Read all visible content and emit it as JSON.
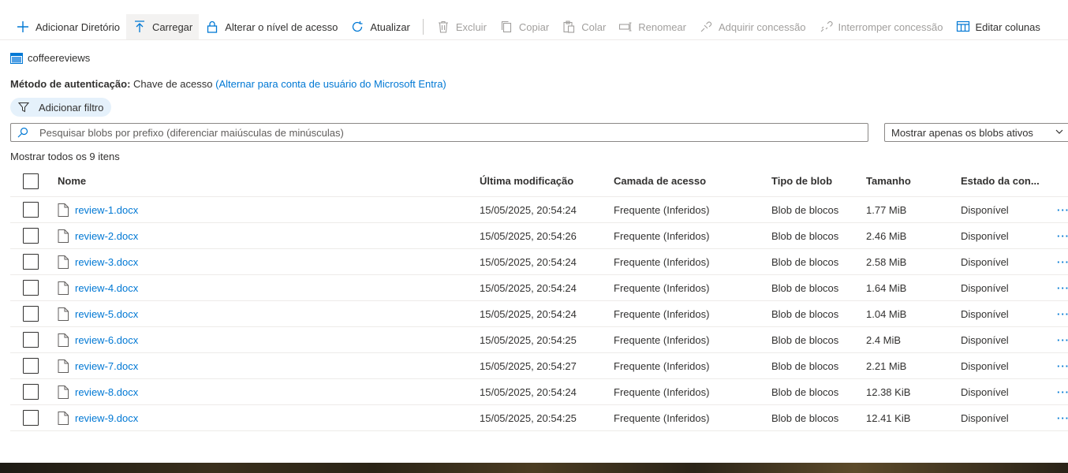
{
  "toolbar": {
    "add_directory": "Adicionar Diretório",
    "upload": "Carregar",
    "change_access": "Alterar o nível de acesso",
    "refresh": "Atualizar",
    "delete": "Excluir",
    "copy": "Copiar",
    "paste": "Colar",
    "rename": "Renomear",
    "acquire_lease": "Adquirir concessão",
    "break_lease": "Interromper concessão",
    "edit_columns": "Editar colunas"
  },
  "container_name": "coffeereviews",
  "auth": {
    "label": "Método de autenticação:",
    "value": "Chave de acesso",
    "switch_link": "(Alternar para conta de usuário do Microsoft Entra)"
  },
  "filter_button": "Adicionar filtro",
  "search": {
    "placeholder": "Pesquisar blobs por prefixo (diferenciar maiúsculas de minúsculas)",
    "value": ""
  },
  "blob_filter": {
    "selected": "Mostrar apenas os blobs ativos"
  },
  "items_count_label": "Mostrar todos os 9 itens",
  "columns": {
    "name": "Nome",
    "modified": "Última modificação",
    "tier": "Camada de acesso",
    "type": "Tipo de blob",
    "size": "Tamanho",
    "state": "Estado da con..."
  },
  "rows": [
    {
      "name": "review-1.docx",
      "modified": "15/05/2025, 20:54:24",
      "tier": "Frequente (Inferidos)",
      "type": "Blob de blocos",
      "size": "1.77 MiB",
      "state": "Disponível",
      "more": "···"
    },
    {
      "name": "review-2.docx",
      "modified": "15/05/2025, 20:54:26",
      "tier": "Frequente (Inferidos)",
      "type": "Blob de blocos",
      "size": "2.46 MiB",
      "state": "Disponível",
      "more": "···"
    },
    {
      "name": "review-3.docx",
      "modified": "15/05/2025, 20:54:24",
      "tier": "Frequente (Inferidos)",
      "type": "Blob de blocos",
      "size": "2.58 MiB",
      "state": "Disponível",
      "more": "···"
    },
    {
      "name": "review-4.docx",
      "modified": "15/05/2025, 20:54:24",
      "tier": "Frequente (Inferidos)",
      "type": "Blob de blocos",
      "size": "1.64 MiB",
      "state": "Disponível",
      "more": "···"
    },
    {
      "name": "review-5.docx",
      "modified": "15/05/2025, 20:54:24",
      "tier": "Frequente (Inferidos)",
      "type": "Blob de blocos",
      "size": "1.04 MiB",
      "state": "Disponível",
      "more": "···"
    },
    {
      "name": "review-6.docx",
      "modified": "15/05/2025, 20:54:25",
      "tier": "Frequente (Inferidos)",
      "type": "Blob de blocos",
      "size": "2.4 MiB",
      "state": "Disponível",
      "more": "···"
    },
    {
      "name": "review-7.docx",
      "modified": "15/05/2025, 20:54:27",
      "tier": "Frequente (Inferidos)",
      "type": "Blob de blocos",
      "size": "2.21 MiB",
      "state": "Disponível",
      "more": "···"
    },
    {
      "name": "review-8.docx",
      "modified": "15/05/2025, 20:54:24",
      "tier": "Frequente (Inferidos)",
      "type": "Blob de blocos",
      "size": "12.38 KiB",
      "state": "Disponível",
      "more": "···"
    },
    {
      "name": "review-9.docx",
      "modified": "15/05/2025, 20:54:25",
      "tier": "Frequente (Inferidos)",
      "type": "Blob de blocos",
      "size": "12.41 KiB",
      "state": "Disponível",
      "more": "···"
    }
  ],
  "colors": {
    "accent": "#0078d4",
    "disabled": "#a19f9d",
    "text": "#323130"
  }
}
